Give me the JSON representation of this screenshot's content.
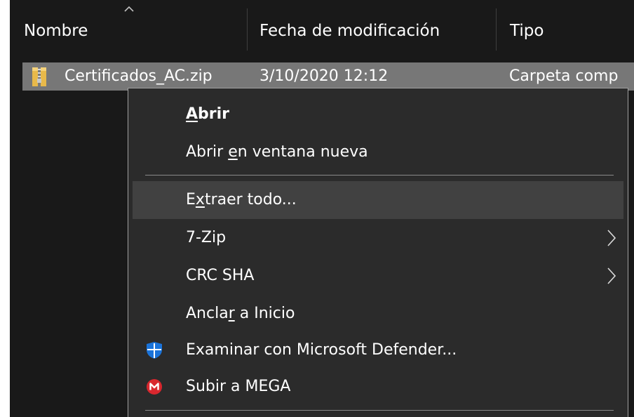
{
  "columns": {
    "name": "Nombre",
    "date": "Fecha de modificación",
    "type": "Tipo"
  },
  "file": {
    "name": "Certificados_AC.zip",
    "date": "3/10/2020 12:12",
    "type": "Carpeta comp",
    "icon": "zip-folder-icon"
  },
  "context_menu": {
    "items": [
      {
        "pre": "",
        "u": "A",
        "post": "brir",
        "bold": true
      },
      {
        "pre": "Abrir ",
        "u": "e",
        "post": "n ventana nueva"
      },
      {
        "pre": "E",
        "u": "x",
        "post": "traer todo..."
      },
      {
        "pre": "7-Zip",
        "u": "",
        "post": ""
      },
      {
        "pre": "CRC SHA",
        "u": "",
        "post": ""
      },
      {
        "pre": "Ancla",
        "u": "r",
        "post": " a Inicio"
      },
      {
        "pre": "Examinar con Microsoft Defender...",
        "u": "",
        "post": "",
        "icon": "defender-shield-icon"
      },
      {
        "pre": "Subir a MEGA",
        "u": "",
        "post": "",
        "icon": "mega-icon"
      }
    ]
  },
  "colors": {
    "background": "#191919",
    "selected_row": "#777777",
    "menu_background": "#2b2b2b",
    "menu_hover": "#414141",
    "defender_blue": "#1a73d9",
    "mega_red": "#d9272e"
  }
}
